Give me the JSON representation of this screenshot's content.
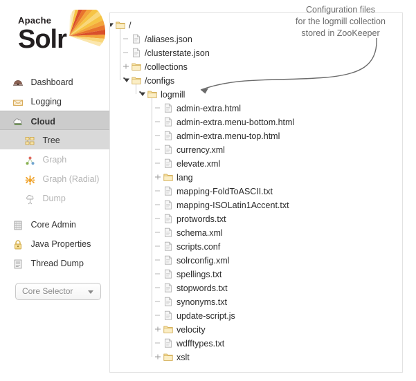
{
  "brand": {
    "apache": "Apache",
    "solr": "Solr",
    "logo_icon": "solr-sunburst-logo"
  },
  "sidebar": {
    "items": [
      {
        "label": "Dashboard",
        "icon": "dashboard-icon",
        "state": "normal"
      },
      {
        "label": "Logging",
        "icon": "logging-icon",
        "state": "normal"
      },
      {
        "label": "Cloud",
        "icon": "cloud-icon",
        "state": "active"
      }
    ],
    "subitems": [
      {
        "label": "Tree",
        "icon": "tree-icon",
        "state": "selected"
      },
      {
        "label": "Graph",
        "icon": "graph-icon",
        "state": "disabled"
      },
      {
        "label": "Graph (Radial)",
        "icon": "graph-radial-icon",
        "state": "disabled"
      },
      {
        "label": "Dump",
        "icon": "dump-icon",
        "state": "disabled"
      }
    ],
    "lower_items": [
      {
        "label": "Core Admin",
        "icon": "core-admin-icon",
        "state": "normal"
      },
      {
        "label": "Java Properties",
        "icon": "java-properties-icon",
        "state": "normal"
      },
      {
        "label": "Thread Dump",
        "icon": "thread-dump-icon",
        "state": "normal"
      }
    ],
    "core_selector": {
      "label": "Core Selector",
      "caret_icon": "chevron-down-icon"
    }
  },
  "tree": {
    "nodes": [
      {
        "label": "/",
        "type": "folder",
        "depth": 0,
        "toggle": "expanded"
      },
      {
        "label": "/aliases.json",
        "type": "file",
        "depth": 1,
        "toggle": "leaf"
      },
      {
        "label": "/clusterstate.json",
        "type": "file",
        "depth": 1,
        "toggle": "leaf"
      },
      {
        "label": "/collections",
        "type": "folder",
        "depth": 1,
        "toggle": "collapsed"
      },
      {
        "label": "/configs",
        "type": "folder",
        "depth": 1,
        "toggle": "expanded"
      },
      {
        "label": "logmill",
        "type": "folder",
        "depth": 2,
        "toggle": "expanded"
      },
      {
        "label": "admin-extra.html",
        "type": "file",
        "depth": 3,
        "toggle": "leaf"
      },
      {
        "label": "admin-extra.menu-bottom.html",
        "type": "file",
        "depth": 3,
        "toggle": "leaf"
      },
      {
        "label": "admin-extra.menu-top.html",
        "type": "file",
        "depth": 3,
        "toggle": "leaf"
      },
      {
        "label": "currency.xml",
        "type": "file",
        "depth": 3,
        "toggle": "leaf"
      },
      {
        "label": "elevate.xml",
        "type": "file",
        "depth": 3,
        "toggle": "leaf"
      },
      {
        "label": "lang",
        "type": "folder",
        "depth": 3,
        "toggle": "collapsed"
      },
      {
        "label": "mapping-FoldToASCII.txt",
        "type": "file",
        "depth": 3,
        "toggle": "leaf"
      },
      {
        "label": "mapping-ISOLatin1Accent.txt",
        "type": "file",
        "depth": 3,
        "toggle": "leaf"
      },
      {
        "label": "protwords.txt",
        "type": "file",
        "depth": 3,
        "toggle": "leaf"
      },
      {
        "label": "schema.xml",
        "type": "file",
        "depth": 3,
        "toggle": "leaf"
      },
      {
        "label": "scripts.conf",
        "type": "file",
        "depth": 3,
        "toggle": "leaf"
      },
      {
        "label": "solrconfig.xml",
        "type": "file",
        "depth": 3,
        "toggle": "leaf"
      },
      {
        "label": "spellings.txt",
        "type": "file",
        "depth": 3,
        "toggle": "leaf"
      },
      {
        "label": "stopwords.txt",
        "type": "file",
        "depth": 3,
        "toggle": "leaf"
      },
      {
        "label": "synonyms.txt",
        "type": "file",
        "depth": 3,
        "toggle": "leaf"
      },
      {
        "label": "update-script.js",
        "type": "file",
        "depth": 3,
        "toggle": "leaf"
      },
      {
        "label": "velocity",
        "type": "folder",
        "depth": 3,
        "toggle": "collapsed"
      },
      {
        "label": "wdfftypes.txt",
        "type": "file",
        "depth": 3,
        "toggle": "leaf"
      },
      {
        "label": "xslt",
        "type": "folder",
        "depth": 3,
        "toggle": "collapsed"
      }
    ]
  },
  "annotation": {
    "line1": "Configuration files",
    "line2": "for the logmill collection",
    "line3": "stored in ZooKeeper",
    "arrow_icon": "curved-arrow-icon"
  },
  "colors": {
    "folder": "#f5dfa0",
    "file": "#f2f2f2",
    "active_nav": "#cccccc",
    "selected_nav": "#d9d9d9",
    "annotation_text": "#6b6b6b",
    "logo_orange": "#d94f2b"
  }
}
